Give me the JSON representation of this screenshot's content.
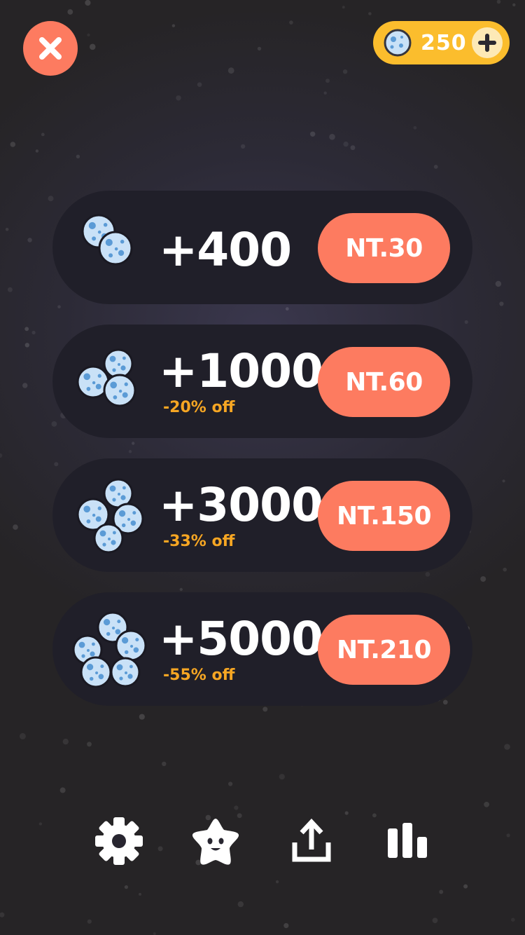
{
  "header": {
    "close_icon": "close-icon",
    "coin_balance": "250",
    "coin_icon": "asteroid-coin-icon",
    "add_icon": "plus-icon"
  },
  "offers": [
    {
      "amount": "+400",
      "discount": "",
      "price": "NT.30",
      "icon": "asteroid-pack-small-icon"
    },
    {
      "amount": "+1000",
      "discount": "-20% off",
      "price": "NT.60",
      "icon": "asteroid-pack-medium-icon"
    },
    {
      "amount": "+3000",
      "discount": "-33% off",
      "price": "NT.150",
      "icon": "asteroid-pack-large-icon"
    },
    {
      "amount": "+5000",
      "discount": "-55% off",
      "price": "NT.210",
      "icon": "asteroid-pack-xlarge-icon"
    }
  ],
  "bottom_bar": [
    "gear-icon",
    "star-face-icon",
    "share-icon",
    "leaderboard-icon"
  ],
  "colors": {
    "accent": "#fd7b60",
    "coin": "#fbbd2d",
    "discount": "#f6a623",
    "card": "#201f29",
    "asteroid": "#c9e1f7",
    "crater": "#5b9bd6"
  }
}
